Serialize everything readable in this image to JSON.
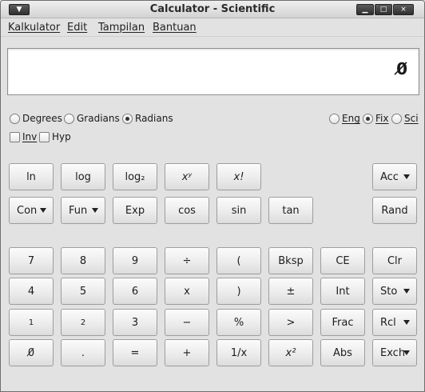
{
  "window": {
    "title": "Calculator - Scientific",
    "menu_glyph": "▼",
    "min_glyph": "▁",
    "max_glyph": "□",
    "close_glyph": "×"
  },
  "menubar": {
    "items": [
      "Kalkulator",
      "Edit",
      "Tampilan",
      "Bantuan"
    ]
  },
  "display": {
    "value": "0̸"
  },
  "angle_units": {
    "options": [
      {
        "label": "Degrees",
        "selected": false
      },
      {
        "label": "Gradians",
        "selected": false
      },
      {
        "label": "Radians",
        "selected": true
      }
    ]
  },
  "modifiers": {
    "inv": {
      "label": "Inv",
      "checked": false
    },
    "hyp": {
      "label": "Hyp",
      "checked": false
    }
  },
  "display_mode": {
    "options": [
      {
        "label": "Eng",
        "selected": false
      },
      {
        "label": "Fix",
        "selected": true
      },
      {
        "label": "Sci",
        "selected": false
      }
    ]
  },
  "buttons": {
    "ln": "ln",
    "log": "log",
    "log2": "log₂",
    "xy": "xʸ",
    "fact": "x!",
    "acc": "Acc",
    "con": "Con",
    "fun": "Fun",
    "exp": "Exp",
    "cos": "cos",
    "sin": "sin",
    "tan": "tan",
    "rand": "Rand",
    "d7": "7",
    "d8": "8",
    "d9": "9",
    "div": "÷",
    "lparen": "(",
    "bksp": "Bksp",
    "ce": "CE",
    "clr": "Clr",
    "d4": "4",
    "d5": "5",
    "d6": "6",
    "mul": "x",
    "rparen": ")",
    "pm": "±",
    "int": "Int",
    "sto": "Sto",
    "d1": "1",
    "d2": "2",
    "d3": "3",
    "minus": "−",
    "percent": "%",
    "gt": ">",
    "frac": "Frac",
    "rcl": "Rcl",
    "d0": "0̸",
    "dot": ".",
    "eq": "=",
    "plus": "+",
    "recip": "1/x",
    "sq": "x²",
    "abs": "Abs",
    "exch": "Exch"
  }
}
